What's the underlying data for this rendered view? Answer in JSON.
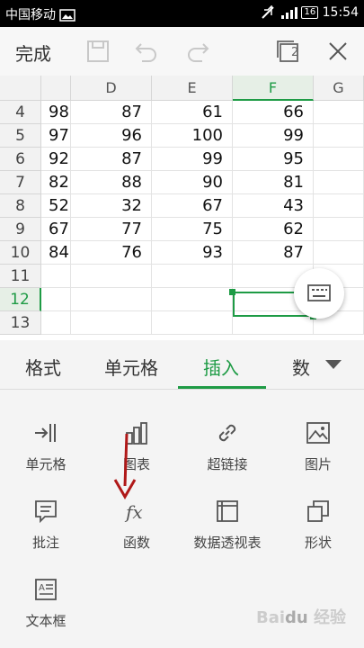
{
  "status_bar": {
    "carrier": "中国移动",
    "battery": "16",
    "time": "15:54"
  },
  "toolbar": {
    "done_label": "完成",
    "window_count": "2"
  },
  "sheet": {
    "columns": [
      "D",
      "E",
      "F",
      "G"
    ],
    "selected_column": "F",
    "selected_row": "12",
    "rows": [
      {
        "num": "4",
        "c": "98",
        "d": "87",
        "e": "61",
        "f": "66"
      },
      {
        "num": "5",
        "c": "97",
        "d": "96",
        "e": "100",
        "f": "99"
      },
      {
        "num": "6",
        "c": "92",
        "d": "87",
        "e": "99",
        "f": "95"
      },
      {
        "num": "7",
        "c": "82",
        "d": "88",
        "e": "90",
        "f": "81"
      },
      {
        "num": "8",
        "c": "52",
        "d": "32",
        "e": "67",
        "f": "43"
      },
      {
        "num": "9",
        "c": "67",
        "d": "77",
        "e": "75",
        "f": "62"
      },
      {
        "num": "10",
        "c": "84",
        "d": "76",
        "e": "93",
        "f": "87"
      },
      {
        "num": "11",
        "c": "",
        "d": "",
        "e": "",
        "f": ""
      },
      {
        "num": "12",
        "c": "",
        "d": "",
        "e": "",
        "f": ""
      },
      {
        "num": "13",
        "c": "",
        "d": "",
        "e": "",
        "f": ""
      }
    ]
  },
  "tabs": [
    {
      "label": "格式"
    },
    {
      "label": "单元格"
    },
    {
      "label": "插入"
    },
    {
      "label": "数"
    }
  ],
  "active_tab": "插入",
  "insert_tools": [
    {
      "label": "单元格",
      "icon": "insert-cell-icon"
    },
    {
      "label": "图表",
      "icon": "chart-icon"
    },
    {
      "label": "超链接",
      "icon": "link-icon"
    },
    {
      "label": "图片",
      "icon": "image-icon"
    },
    {
      "label": "批注",
      "icon": "comment-icon"
    },
    {
      "label": "函数",
      "icon": "function-icon"
    },
    {
      "label": "数据透视表",
      "icon": "pivot-table-icon"
    },
    {
      "label": "形状",
      "icon": "shape-icon"
    },
    {
      "label": "文本框",
      "icon": "textbox-icon"
    }
  ],
  "colors": {
    "accent": "#1e9b45",
    "arrow": "#b01818"
  }
}
